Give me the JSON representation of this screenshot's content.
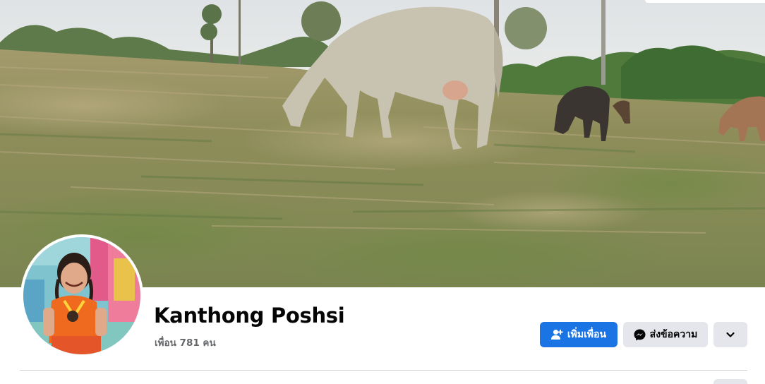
{
  "profile": {
    "name": "Kanthong Poshsi",
    "friends_text": "เพื่อน 781 คน"
  },
  "actions": {
    "add_friend_label": "เพิ่มเพื่อน",
    "message_label": "ส่งข้อความ"
  },
  "icons": {
    "add_friend": "add-friend-icon",
    "message": "messenger-icon",
    "more": "chevron-down-icon"
  },
  "colors": {
    "primary_button": "#1b74e4",
    "secondary_button": "#e4e6eb",
    "name_text": "#050505",
    "meta_text": "#65676b"
  }
}
